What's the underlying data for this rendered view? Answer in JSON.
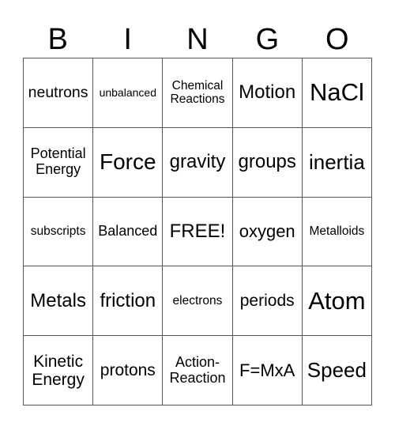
{
  "header": {
    "letters": [
      "B",
      "I",
      "N",
      "G",
      "O"
    ]
  },
  "board": {
    "rows": [
      [
        "neutrons",
        "unbalanced",
        "Chemical\nReactions",
        "Motion",
        "NaCl"
      ],
      [
        "Potential\nEnergy",
        "Force",
        "gravity",
        "groups",
        "inertia"
      ],
      [
        "subscripts",
        "Balanced",
        "FREE!",
        "oxygen",
        "Metalloids"
      ],
      [
        "Metals",
        "friction",
        "electrons",
        "periods",
        "Atom"
      ],
      [
        "Kinetic\nEnergy",
        "protons",
        "Action-\nReaction",
        "F=MxA",
        "Speed"
      ]
    ]
  }
}
